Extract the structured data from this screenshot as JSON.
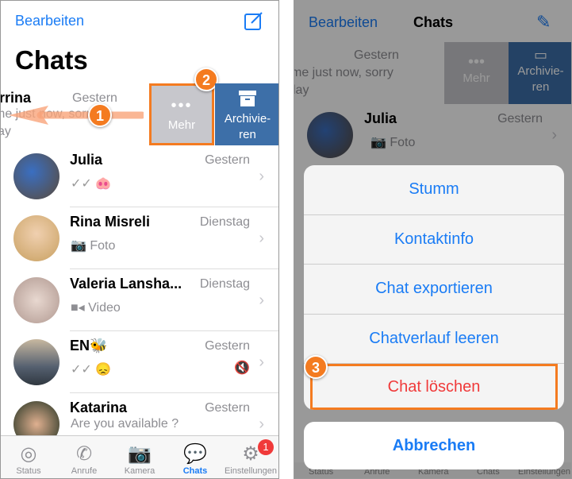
{
  "left": {
    "header": {
      "edit": "Bearbeiten",
      "title": "Chats"
    },
    "swiped_row": {
      "name": "rrina",
      "time": "Gestern",
      "message_line1": "me just now, sorry",
      "message_line2": "ay",
      "more": "Mehr",
      "archive": "Archivie-\nren"
    },
    "chats": [
      {
        "name": "Julia",
        "time": "Gestern",
        "message": "🐽",
        "ticks": "✓✓"
      },
      {
        "name": "Rina Misreli",
        "time": "Dienstag",
        "message": "Foto",
        "icon": "camera-icon"
      },
      {
        "name": "Valeria Lansha...",
        "time": "Dienstag",
        "message": "Video",
        "icon": "video-icon"
      },
      {
        "name": "EN🐝",
        "time": "Gestern",
        "message": "😞",
        "ticks": "✓✓",
        "muted": true
      },
      {
        "name": "Katarina",
        "time": "Gestern",
        "message": "Are you available ?"
      }
    ],
    "tabs": [
      {
        "label": "Status",
        "icon": "status-icon"
      },
      {
        "label": "Anrufe",
        "icon": "phone-icon"
      },
      {
        "label": "Kamera",
        "icon": "camera-icon"
      },
      {
        "label": "Chats",
        "icon": "chats-icon",
        "active": true
      },
      {
        "label": "Einstellungen",
        "icon": "gear-icon",
        "badge": "1"
      }
    ],
    "steps": [
      "1",
      "2"
    ]
  },
  "right": {
    "header": {
      "edit": "Bearbeiten",
      "title": "Chats"
    },
    "swiped_row": {
      "time": "Gestern",
      "message_line1": "me just now, sorry",
      "message_line2": "lay",
      "more": "Mehr",
      "archive": "Archivie-\nren"
    },
    "chat": {
      "name": "Julia",
      "time": "Gestern",
      "message": "Foto"
    },
    "sheet": {
      "items": [
        "Stumm",
        "Kontaktinfo",
        "Chat exportieren",
        "Chatverlauf leeren",
        "Chat löschen"
      ],
      "cancel": "Abbrechen"
    },
    "tabs": [
      "Status",
      "Anrufe",
      "Kamera",
      "Chats",
      "Einstellungen"
    ],
    "step": "3"
  },
  "colors": {
    "accent": "#1a7cf5",
    "highlight": "#f47b20",
    "archive": "#3d6fa8",
    "destructive": "#f03a3a"
  }
}
